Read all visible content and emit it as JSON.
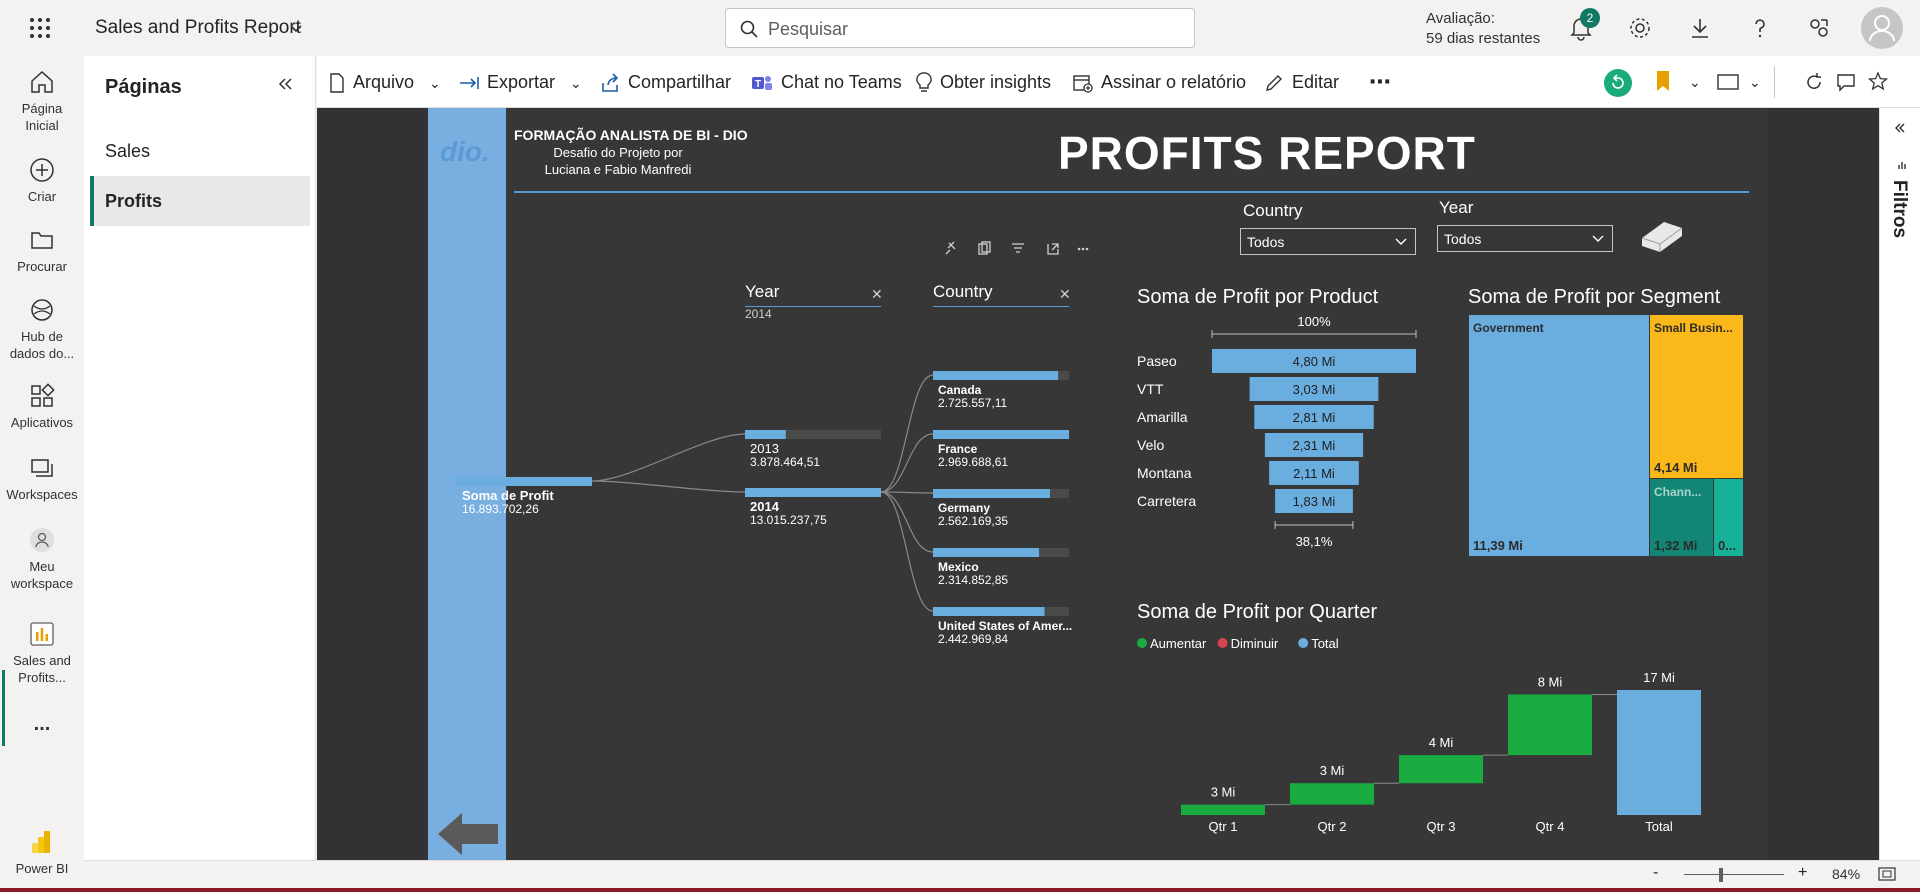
{
  "app": {
    "title": "Sales and Profits Report",
    "search_placeholder": "Pesquisar",
    "trial_label": "Avaliação:",
    "trial_days": "59 dias restantes",
    "notification_count": "2"
  },
  "rail": {
    "items": [
      {
        "label1": "Página",
        "label2": "Inicial"
      },
      {
        "label1": "Criar",
        "label2": ""
      },
      {
        "label1": "Procurar",
        "label2": ""
      },
      {
        "label1": "Hub de",
        "label2": "dados do..."
      },
      {
        "label1": "Aplicativos",
        "label2": ""
      },
      {
        "label1": "Workspaces",
        "label2": ""
      },
      {
        "label1": "Meu",
        "label2": "workspace"
      },
      {
        "label1": "Sales and",
        "label2": "Profits..."
      },
      {
        "label1": "...",
        "label2": ""
      },
      {
        "label1": "Power BI",
        "label2": ""
      }
    ]
  },
  "pages": {
    "title": "Páginas",
    "items": [
      "Sales",
      "Profits"
    ],
    "active": "Profits"
  },
  "toolbar": {
    "arquivo": "Arquivo",
    "exportar": "Exportar",
    "compartilhar": "Compartilhar",
    "teams": "Chat no Teams",
    "insights": "Obter insights",
    "assinar": "Assinar o relatório",
    "editar": "Editar",
    "more": "⋯"
  },
  "report": {
    "org_title": "FORMAÇÃO ANALISTA DE BI - DIO",
    "org_sub1": "Desafio do Projeto por",
    "org_sub2": "Luciana e Fabio Manfredi",
    "title": "PROFITS REPORT",
    "logo": "dio."
  },
  "slicers": {
    "country_label": "Country",
    "country_value": "Todos",
    "year_label": "Year",
    "year_value": "Todos"
  },
  "decomp": {
    "col_year": "Year",
    "col_year_sel": "2014",
    "col_country": "Country",
    "root_label": "Soma de Profit",
    "root_value": "16.893.702,26",
    "years": [
      {
        "label": "2013",
        "value": "3.878.464,51",
        "fill": 0.3
      },
      {
        "label": "2014",
        "value": "13.015.237,75",
        "fill": 1.0
      }
    ],
    "countries": [
      {
        "label": "Canada",
        "value": "2.725.557,11",
        "fill": 0.92
      },
      {
        "label": "France",
        "value": "2.969.688,61",
        "fill": 1.0
      },
      {
        "label": "Germany",
        "value": "2.562.169,35",
        "fill": 0.86
      },
      {
        "label": "Mexico",
        "value": "2.314.852,85",
        "fill": 0.78
      },
      {
        "label": "United States of Amer...",
        "value": "2.442.969,84",
        "fill": 0.82
      }
    ]
  },
  "funnel": {
    "title": "Soma de Profit por Product",
    "top_pct": "100%",
    "bottom_pct": "38,1%",
    "products": [
      "Paseo",
      "VTT",
      "Amarilla",
      "Velo",
      "Montana",
      "Carretera"
    ],
    "values_label": [
      "4,80 Mi",
      "3,03 Mi",
      "2,81 Mi",
      "2,31 Mi",
      "2,11 Mi",
      "1,83 Mi"
    ],
    "values": [
      4.8,
      3.03,
      2.81,
      2.31,
      2.11,
      1.83
    ]
  },
  "treemap": {
    "title": "Soma de Profit por Segment",
    "segments": [
      {
        "name": "Government",
        "label": "11,39 Mi",
        "color": "#6aaee0"
      },
      {
        "name": "Small Busin...",
        "label": "4,14 Mi",
        "color": "#fbb81a"
      },
      {
        "name": "Chann...",
        "label": "1,32 Mi",
        "color": "#138575"
      },
      {
        "name": "",
        "label": "0...",
        "color": "#17b098"
      }
    ]
  },
  "waterfall": {
    "title": "Soma de Profit por Quarter",
    "legend": [
      "Aumentar",
      "Diminuir",
      "Total"
    ],
    "legend_colors": [
      "#1aab40",
      "#d64550",
      "#6aaee0"
    ],
    "categories": [
      "Qtr 1",
      "Qtr 2",
      "Qtr 3",
      "Qtr 4",
      "Total"
    ],
    "labels": [
      "3 Mi",
      "3 Mi",
      "4 Mi",
      "8 Mi",
      "17 Mi"
    ],
    "increments": [
      1.4,
      2.9,
      3.8,
      8.2
    ],
    "total": 16.9
  },
  "status": {
    "zoom": "84%",
    "minus": "-",
    "plus": "+"
  },
  "filters": {
    "label": "Filtros"
  }
}
